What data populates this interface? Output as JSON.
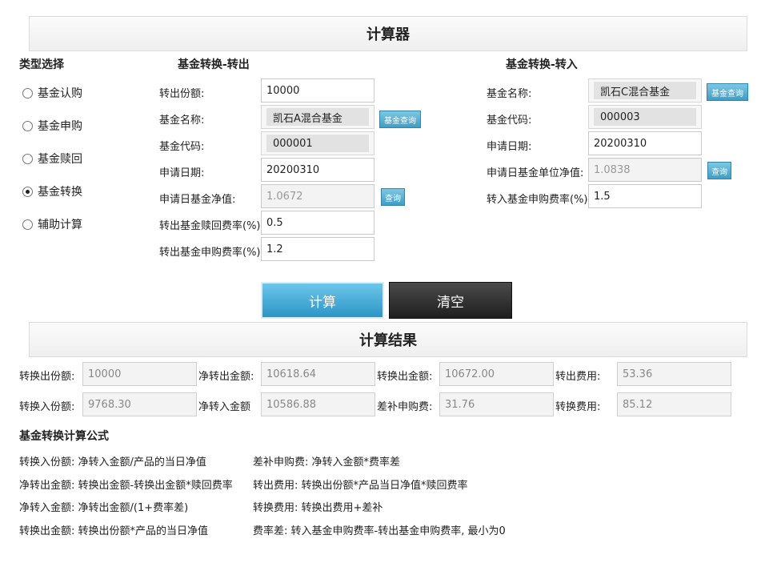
{
  "title": "计算器",
  "type_select": {
    "heading": "类型选择",
    "options": [
      {
        "label": "基金认购",
        "checked": false
      },
      {
        "label": "基金申购",
        "checked": false
      },
      {
        "label": "基金赎回",
        "checked": false
      },
      {
        "label": "基金转换",
        "checked": true
      },
      {
        "label": "辅助计算",
        "checked": false
      }
    ]
  },
  "transfer_out": {
    "heading": "基金转换-转出",
    "shares_label": "转出份额:",
    "shares_value": "10000",
    "fund_name_label": "基金名称:",
    "fund_name_value": "凯石A混合基金",
    "fund_query_button": "基金查询",
    "fund_code_label": "基金代码:",
    "fund_code_value": "000001",
    "apply_date_label": "申请日期:",
    "apply_date_value": "20200310",
    "nav_label": "申请日基金净值:",
    "nav_value": "1.0672",
    "query_button": "查询",
    "redeem_fee_label": "转出基金赎回费率(%):",
    "redeem_fee_value": "0.5",
    "purchase_fee_label": "转出基金申购费率(%):",
    "purchase_fee_value": "1.2"
  },
  "transfer_in": {
    "heading": "基金转换-转入",
    "fund_name_label": "基金名称:",
    "fund_name_value": "凯石C混合基金",
    "fund_query_button": "基金查询",
    "fund_code_label": "基金代码:",
    "fund_code_value": "000003",
    "apply_date_label": "申请日期:",
    "apply_date_value": "20200310",
    "unit_nav_label": "申请日基金单位净值:",
    "unit_nav_value": "1.0838",
    "query_button": "查询",
    "purchase_fee_label": "转入基金申购费率(%):",
    "purchase_fee_value": "1.5"
  },
  "buttons": {
    "calculate": "计算",
    "clear": "清空"
  },
  "results": {
    "heading": "计算结果",
    "row1": [
      {
        "label": "转换出份额:",
        "value": "10000"
      },
      {
        "label": "净转出金额:",
        "value": "10618.64"
      },
      {
        "label": "转换出金额:",
        "value": "10672.00"
      },
      {
        "label": "转出费用:",
        "value": "53.36"
      }
    ],
    "row2": [
      {
        "label": "转换入份额:",
        "value": "9768.30"
      },
      {
        "label": "净转入金额",
        "value": "10586.88"
      },
      {
        "label": "差补申购费:",
        "value": "31.76"
      },
      {
        "label": "转换费用:",
        "value": "85.12"
      }
    ]
  },
  "formulas": {
    "heading": "基金转换计算公式",
    "left": [
      "转换入份额: 净转入金额/产品的当日净值",
      "净转出金额: 转换出金额-转换出金额*赎回费率",
      "净转入金额: 净转出金额/(1+费率差)",
      "转换出金额: 转换出份额*产品的当日净值"
    ],
    "right": [
      "差补申购费: 净转入金额*费率差",
      "转出费用: 转换出份额*产品当日净值*赎回费率",
      "转换费用: 转换出费用+差补",
      "费率差: 转入基金申购费率-转出基金申购费率, 最小为0"
    ]
  }
}
